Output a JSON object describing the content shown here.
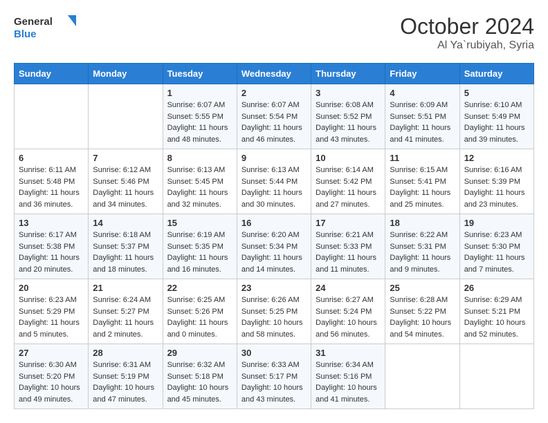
{
  "header": {
    "logo_line1": "General",
    "logo_line2": "Blue",
    "month": "October 2024",
    "location": "Al Ya`rubiyah, Syria"
  },
  "days_of_week": [
    "Sunday",
    "Monday",
    "Tuesday",
    "Wednesday",
    "Thursday",
    "Friday",
    "Saturday"
  ],
  "weeks": [
    [
      {
        "day": "",
        "info": ""
      },
      {
        "day": "",
        "info": ""
      },
      {
        "day": "1",
        "info": "Sunrise: 6:07 AM\nSunset: 5:55 PM\nDaylight: 11 hours and 48 minutes."
      },
      {
        "day": "2",
        "info": "Sunrise: 6:07 AM\nSunset: 5:54 PM\nDaylight: 11 hours and 46 minutes."
      },
      {
        "day": "3",
        "info": "Sunrise: 6:08 AM\nSunset: 5:52 PM\nDaylight: 11 hours and 43 minutes."
      },
      {
        "day": "4",
        "info": "Sunrise: 6:09 AM\nSunset: 5:51 PM\nDaylight: 11 hours and 41 minutes."
      },
      {
        "day": "5",
        "info": "Sunrise: 6:10 AM\nSunset: 5:49 PM\nDaylight: 11 hours and 39 minutes."
      }
    ],
    [
      {
        "day": "6",
        "info": "Sunrise: 6:11 AM\nSunset: 5:48 PM\nDaylight: 11 hours and 36 minutes."
      },
      {
        "day": "7",
        "info": "Sunrise: 6:12 AM\nSunset: 5:46 PM\nDaylight: 11 hours and 34 minutes."
      },
      {
        "day": "8",
        "info": "Sunrise: 6:13 AM\nSunset: 5:45 PM\nDaylight: 11 hours and 32 minutes."
      },
      {
        "day": "9",
        "info": "Sunrise: 6:13 AM\nSunset: 5:44 PM\nDaylight: 11 hours and 30 minutes."
      },
      {
        "day": "10",
        "info": "Sunrise: 6:14 AM\nSunset: 5:42 PM\nDaylight: 11 hours and 27 minutes."
      },
      {
        "day": "11",
        "info": "Sunrise: 6:15 AM\nSunset: 5:41 PM\nDaylight: 11 hours and 25 minutes."
      },
      {
        "day": "12",
        "info": "Sunrise: 6:16 AM\nSunset: 5:39 PM\nDaylight: 11 hours and 23 minutes."
      }
    ],
    [
      {
        "day": "13",
        "info": "Sunrise: 6:17 AM\nSunset: 5:38 PM\nDaylight: 11 hours and 20 minutes."
      },
      {
        "day": "14",
        "info": "Sunrise: 6:18 AM\nSunset: 5:37 PM\nDaylight: 11 hours and 18 minutes."
      },
      {
        "day": "15",
        "info": "Sunrise: 6:19 AM\nSunset: 5:35 PM\nDaylight: 11 hours and 16 minutes."
      },
      {
        "day": "16",
        "info": "Sunrise: 6:20 AM\nSunset: 5:34 PM\nDaylight: 11 hours and 14 minutes."
      },
      {
        "day": "17",
        "info": "Sunrise: 6:21 AM\nSunset: 5:33 PM\nDaylight: 11 hours and 11 minutes."
      },
      {
        "day": "18",
        "info": "Sunrise: 6:22 AM\nSunset: 5:31 PM\nDaylight: 11 hours and 9 minutes."
      },
      {
        "day": "19",
        "info": "Sunrise: 6:23 AM\nSunset: 5:30 PM\nDaylight: 11 hours and 7 minutes."
      }
    ],
    [
      {
        "day": "20",
        "info": "Sunrise: 6:23 AM\nSunset: 5:29 PM\nDaylight: 11 hours and 5 minutes."
      },
      {
        "day": "21",
        "info": "Sunrise: 6:24 AM\nSunset: 5:27 PM\nDaylight: 11 hours and 2 minutes."
      },
      {
        "day": "22",
        "info": "Sunrise: 6:25 AM\nSunset: 5:26 PM\nDaylight: 11 hours and 0 minutes."
      },
      {
        "day": "23",
        "info": "Sunrise: 6:26 AM\nSunset: 5:25 PM\nDaylight: 10 hours and 58 minutes."
      },
      {
        "day": "24",
        "info": "Sunrise: 6:27 AM\nSunset: 5:24 PM\nDaylight: 10 hours and 56 minutes."
      },
      {
        "day": "25",
        "info": "Sunrise: 6:28 AM\nSunset: 5:22 PM\nDaylight: 10 hours and 54 minutes."
      },
      {
        "day": "26",
        "info": "Sunrise: 6:29 AM\nSunset: 5:21 PM\nDaylight: 10 hours and 52 minutes."
      }
    ],
    [
      {
        "day": "27",
        "info": "Sunrise: 6:30 AM\nSunset: 5:20 PM\nDaylight: 10 hours and 49 minutes."
      },
      {
        "day": "28",
        "info": "Sunrise: 6:31 AM\nSunset: 5:19 PM\nDaylight: 10 hours and 47 minutes."
      },
      {
        "day": "29",
        "info": "Sunrise: 6:32 AM\nSunset: 5:18 PM\nDaylight: 10 hours and 45 minutes."
      },
      {
        "day": "30",
        "info": "Sunrise: 6:33 AM\nSunset: 5:17 PM\nDaylight: 10 hours and 43 minutes."
      },
      {
        "day": "31",
        "info": "Sunrise: 6:34 AM\nSunset: 5:16 PM\nDaylight: 10 hours and 41 minutes."
      },
      {
        "day": "",
        "info": ""
      },
      {
        "day": "",
        "info": ""
      }
    ]
  ]
}
